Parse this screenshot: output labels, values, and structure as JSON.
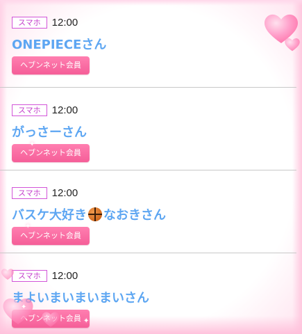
{
  "entries": [
    {
      "badge": "スマホ",
      "time": "12:00",
      "name": "ONEPIECEさん",
      "tag": "ヘブンネット会員"
    },
    {
      "badge": "スマホ",
      "time": "12:00",
      "name": "がっさーさん",
      "tag": "ヘブンネット会員"
    },
    {
      "badge": "スマホ",
      "time": "12:00",
      "name_before": "バスケ大好き",
      "name_after": "なおきさん",
      "name_icon": "basketball-icon",
      "tag": "ヘブンネット会員"
    },
    {
      "badge": "スマホ",
      "time": "12:00",
      "name": "まよいまいまいまいさん",
      "tag": "ヘブンネット会員"
    }
  ],
  "colors": {
    "name": "#5da6f2",
    "badge_border": "#d254d8",
    "tag_bg": "#f766a0",
    "divider": "#c8c8c8",
    "heart": "#ff8fbe"
  },
  "icons": [
    "heart-icon",
    "basketball-icon",
    "sparkle-icon"
  ]
}
